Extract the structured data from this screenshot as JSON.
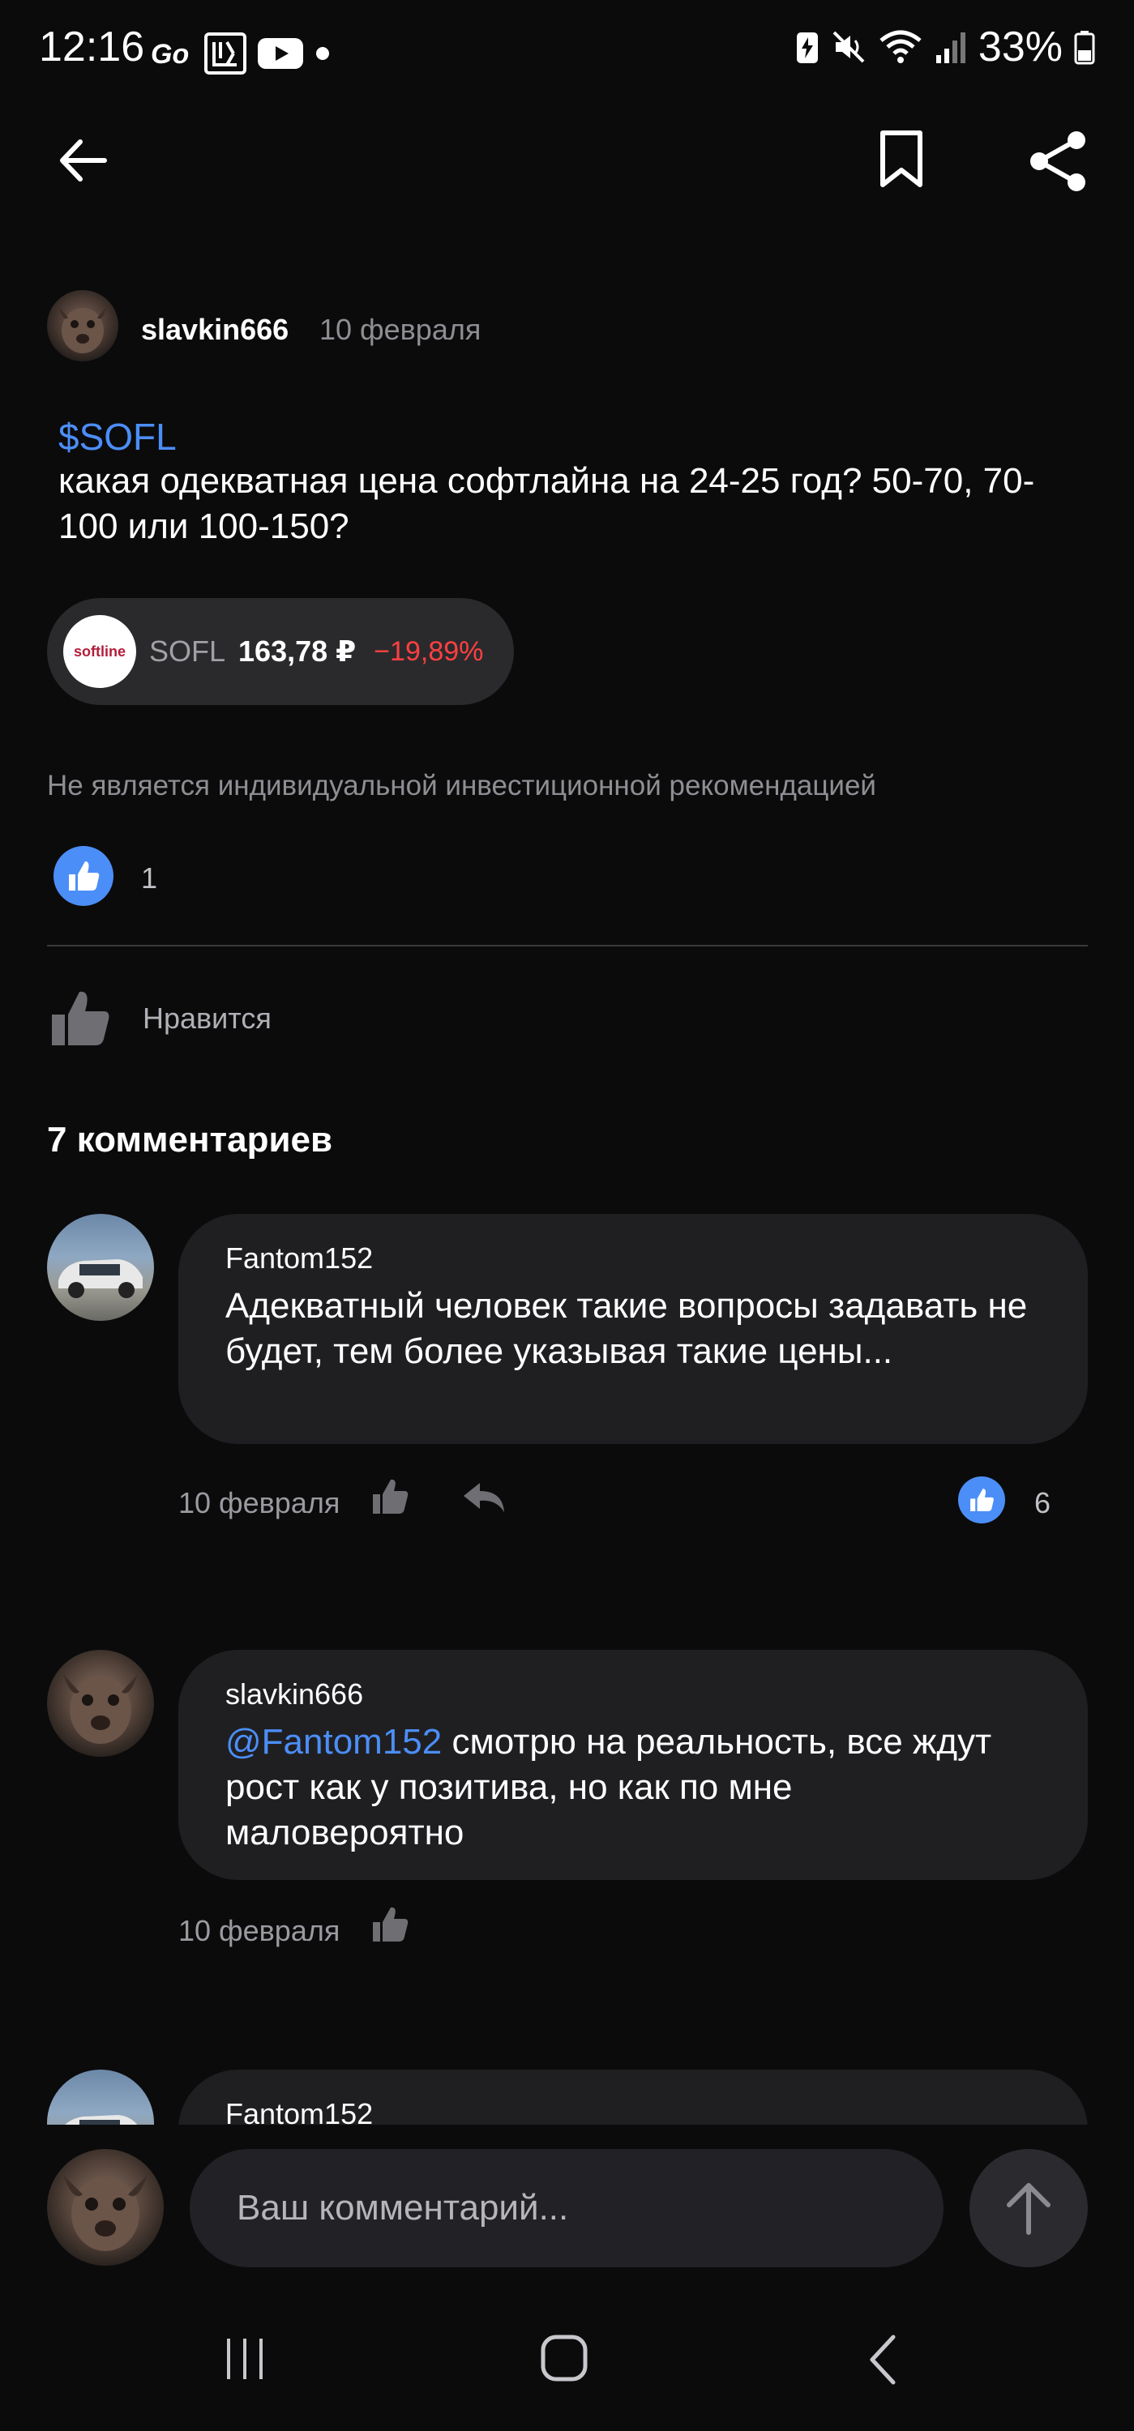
{
  "status_bar": {
    "time": "12:16",
    "battery": "33%"
  },
  "post": {
    "author": "slavkin666",
    "date": "10 февраля",
    "ticker_link": "$SOFL",
    "text": "какая одекватная цена софтлайна на 24-25 год? 50-70, 70-100 или 100-150?",
    "instrument": {
      "logo_text": "softline",
      "ticker": "SOFL",
      "price": "163,78 ₽",
      "change": "−19,89%"
    },
    "disclaimer": "Не является индивидуальной инвестиционной рекомендацией",
    "likes_count": "1",
    "like_label": "Нравится"
  },
  "comments": {
    "title": "7 комментариев",
    "items": [
      {
        "author": "Fantom152",
        "mention": "",
        "text": "Адекватный человек такие вопросы задавать не будет, тем более указывая такие цены...",
        "date": "10 февраля",
        "likes": "6"
      },
      {
        "author": "slavkin666",
        "mention": "@Fantom152",
        "text": " смотрю на реальность, все ждут рост как у позитива, но как по мне маловероятно",
        "date": "10 февраля",
        "likes": ""
      },
      {
        "author": "Fantom152"
      }
    ]
  },
  "input": {
    "placeholder": "Ваш комментарий..."
  },
  "colors": {
    "background": "#0b0b0c",
    "accent": "#4c8ef7",
    "negative": "#ff4040",
    "bubble": "#1f1f22"
  }
}
